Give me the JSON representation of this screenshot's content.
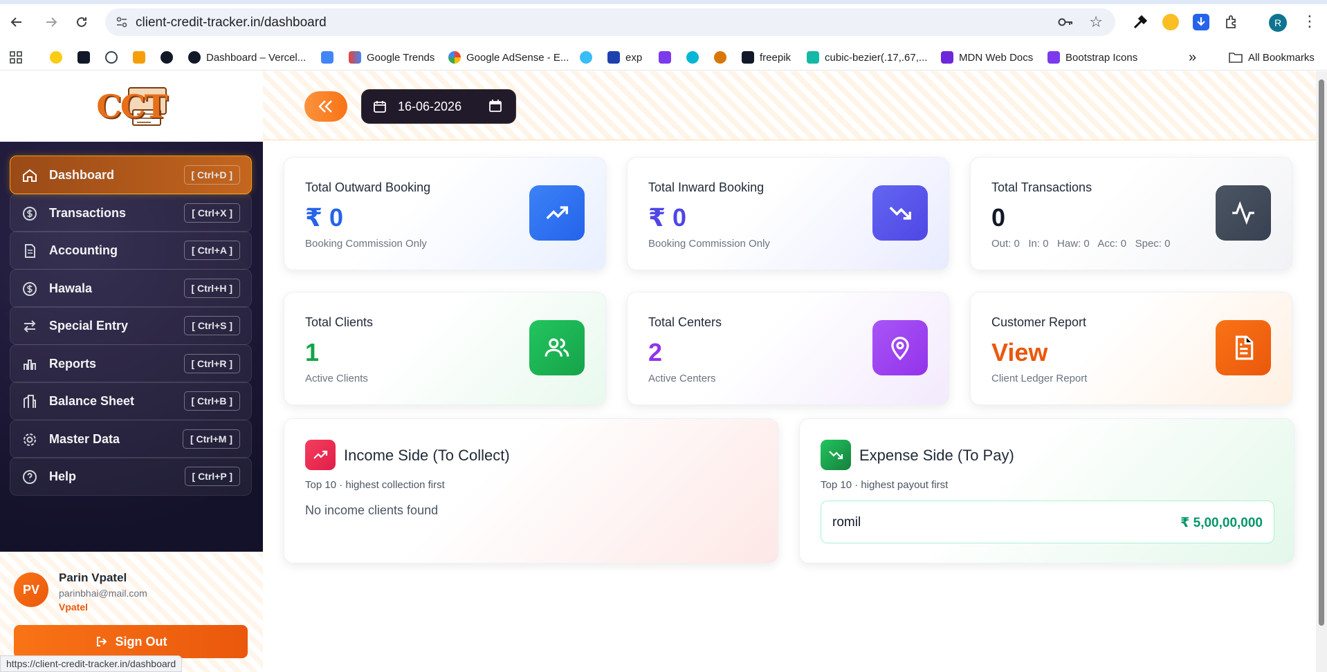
{
  "browser": {
    "url": "client-credit-tracker.in/dashboard",
    "status_url": "https://client-credit-tracker.in/dashboard",
    "profile_initial": "R",
    "bookmarks": [
      {
        "label": "Dashboard – Vercel...",
        "icon": "github-icon"
      },
      {
        "label": "Google Trends",
        "icon": "trends-icon"
      },
      {
        "label": "Google AdSense - E...",
        "icon": "google-icon"
      },
      {
        "label": "exp",
        "icon": "exp-icon"
      },
      {
        "label": "freepik",
        "icon": "freepik-icon"
      },
      {
        "label": "cubic-bezier(.17,.67,...",
        "icon": "bezier-icon"
      },
      {
        "label": "MDN Web Docs",
        "icon": "mdn-icon"
      },
      {
        "label": "Bootstrap Icons",
        "icon": "bootstrap-icon"
      }
    ],
    "all_bookmarks": "All Bookmarks"
  },
  "brand": {
    "logo_text": "CCT"
  },
  "sidebar": {
    "items": [
      {
        "label": "Dashboard",
        "shortcut": "[ Ctrl+D ]",
        "icon": "home-icon"
      },
      {
        "label": "Transactions",
        "shortcut": "[ Ctrl+X ]",
        "icon": "dollar-circle-icon"
      },
      {
        "label": "Accounting",
        "shortcut": "[ Ctrl+A ]",
        "icon": "document-icon"
      },
      {
        "label": "Hawala",
        "shortcut": "[ Ctrl+H ]",
        "icon": "dollar-circle-icon"
      },
      {
        "label": "Special Entry",
        "shortcut": "[ Ctrl+S ]",
        "icon": "swap-icon"
      },
      {
        "label": "Reports",
        "shortcut": "[ Ctrl+R ]",
        "icon": "bar-chart-icon"
      },
      {
        "label": "Balance Sheet",
        "shortcut": "[ Ctrl+B ]",
        "icon": "building-icon"
      },
      {
        "label": "Master Data",
        "shortcut": "[ Ctrl+M ]",
        "icon": "gear-icon"
      },
      {
        "label": "Help",
        "shortcut": "[ Ctrl+P ]",
        "icon": "help-icon"
      }
    ],
    "user": {
      "initials": "PV",
      "name": "Parin Vpatel",
      "email": "parinbhai@mail.com",
      "role": "Vpatel"
    },
    "signout_label": "Sign Out"
  },
  "topbar": {
    "date": "16-06-2026"
  },
  "cards": [
    {
      "title": "Total Outward Booking",
      "value": "₹ 0",
      "sub": "Booking Commission Only",
      "icon": "trending-up-icon",
      "color": "#2563eb"
    },
    {
      "title": "Total Inward Booking",
      "value": "₹ 0",
      "sub": "Booking Commission Only",
      "icon": "trending-down-icon",
      "color": "#4f46e5"
    },
    {
      "title": "Total Transactions",
      "value": "0",
      "sub": "Out: 0   In: 0   Haw: 0   Acc: 0   Spec: 0",
      "icon": "activity-icon",
      "color": "#374151"
    },
    {
      "title": "Total Clients",
      "value": "1",
      "sub": "Active Clients",
      "icon": "users-icon",
      "color": "#16a34a"
    },
    {
      "title": "Total Centers",
      "value": "2",
      "sub": "Active Centers",
      "icon": "map-pin-icon",
      "color": "#9333ea"
    },
    {
      "title": "Customer Report",
      "value": "View",
      "sub": "Client Ledger Report",
      "icon": "file-text-icon",
      "color": "#ea580c"
    }
  ],
  "income": {
    "title": "Income Side (To Collect)",
    "sub": "Top 10 · highest collection first",
    "empty": "No income clients found"
  },
  "expense": {
    "title": "Expense Side (To Pay)",
    "sub": "Top 10 · highest payout first",
    "rows": [
      {
        "name": "romil",
        "amount": "₹ 5,00,00,000"
      }
    ]
  }
}
